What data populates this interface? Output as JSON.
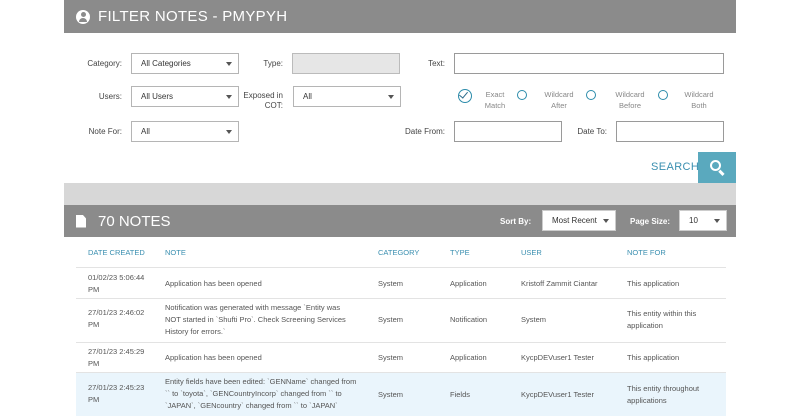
{
  "filter_header": {
    "title": "FILTER NOTES - PMYPYH"
  },
  "filters": {
    "category_label": "Category:",
    "category_value": "All Categories",
    "type_label": "Type:",
    "text_label": "Text:",
    "users_label": "Users:",
    "users_value": "All Users",
    "exposed_label_1": "Exposed in",
    "exposed_label_2": "COT:",
    "exposed_value": "All",
    "match_options": [
      {
        "line1": "Exact",
        "line2": "Match",
        "selected": true
      },
      {
        "line1": "Wildcard",
        "line2": "After",
        "selected": false
      },
      {
        "line1": "Wildcard",
        "line2": "Before",
        "selected": false
      },
      {
        "line1": "Wildcard",
        "line2": "Both",
        "selected": false
      }
    ],
    "note_for_label": "Note For:",
    "note_for_value": "All",
    "date_from_label": "Date From:",
    "date_to_label": "Date To:",
    "search_label": "SEARCH"
  },
  "notes_header": {
    "title": "70 NOTES",
    "sort_by_label": "Sort By:",
    "sort_by_value": "Most Recent",
    "page_size_label": "Page Size:",
    "page_size_value": "10"
  },
  "table": {
    "columns": [
      "DATE CREATED",
      "NOTE",
      "CATEGORY",
      "TYPE",
      "USER",
      "NOTE FOR"
    ],
    "rows": [
      {
        "date": [
          "01/02/23 5:06:44",
          "PM"
        ],
        "note": [
          "Application has been opened"
        ],
        "category": "System",
        "type": "Application",
        "user": "Kristoff Zammit Ciantar",
        "note_for": [
          "This application"
        ]
      },
      {
        "date": [
          "27/01/23 2:46:02",
          "PM"
        ],
        "note": [
          "Notification was generated with message `Entity was",
          "NOT started in `Shufti Pro`. Check Screening Services",
          "History for errors.`"
        ],
        "category": "System",
        "type": "Notification",
        "user": "System",
        "note_for": [
          "This entity within this",
          "application"
        ]
      },
      {
        "date": [
          "27/01/23 2:45:29",
          "PM"
        ],
        "note": [
          "Application has been opened"
        ],
        "category": "System",
        "type": "Application",
        "user": "KycpDEVuser1 Tester",
        "note_for": [
          "This application"
        ]
      },
      {
        "date": [
          "27/01/23 2:45:23",
          "PM"
        ],
        "note": [
          "Entity fields have been edited: `GENName` changed from",
          "`` to `toyota`, `GENCountryIncorp` changed from `` to",
          "`JAPAN`, `GENcountry` changed from `` to `JAPAN`"
        ],
        "category": "System",
        "type": "Fields",
        "user": "KycpDEVuser1 Tester",
        "note_for": [
          "This entity throughout",
          "applications"
        ]
      }
    ]
  },
  "colors": {
    "header": "#8b8b8b",
    "accent": "#3a8fb0",
    "search_button": "#5aa9be",
    "highlight_row": "#eaf5fc"
  }
}
